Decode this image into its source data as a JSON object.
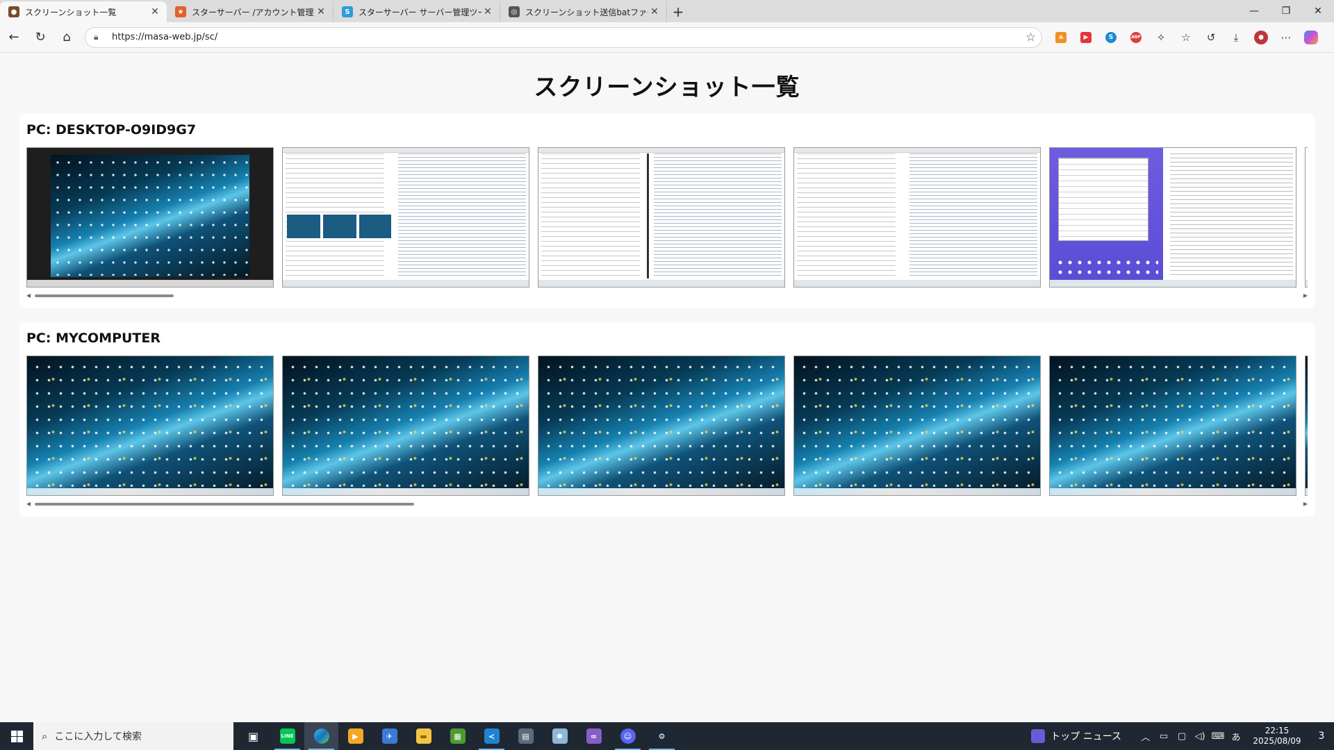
{
  "browser": {
    "tabs": [
      {
        "title": "スクリーンショット一覧",
        "active": true,
        "color": "#7a4a2a"
      },
      {
        "title": "スターサーバー /アカウント管理ツール",
        "active": false,
        "color": "#e0612a"
      },
      {
        "title": "スターサーバー サーバー管理ツール",
        "active": false,
        "color": "#2d9bd8"
      },
      {
        "title": "スクリーンショット送信batファイル",
        "active": false,
        "color": "#555555"
      }
    ],
    "url": "https://masa-web.jp/sc/"
  },
  "page": {
    "title": "スクリーンショット一覧",
    "sections": [
      {
        "pc_label": "PC: DESKTOP-O9ID9G7"
      },
      {
        "pc_label": "PC: MYCOMPUTER"
      }
    ],
    "scroll_positions": [
      0.09,
      0.3
    ]
  },
  "taskbar": {
    "search_placeholder": "ここに入力して検索",
    "news_label": "トップ ニュース",
    "ime_label": "あ",
    "time": "22:15",
    "date": "2025/08/09",
    "notification_count": "3"
  }
}
